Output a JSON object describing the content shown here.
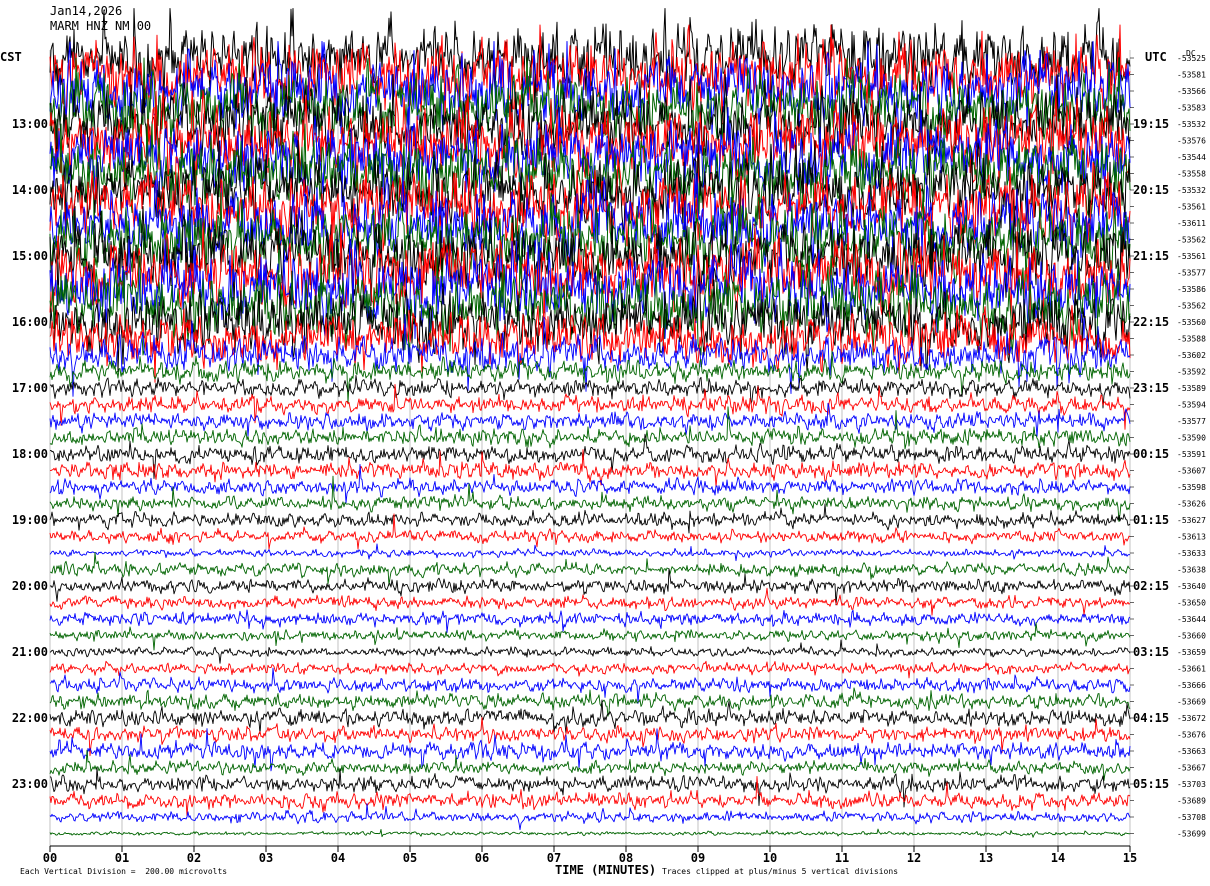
{
  "header": {
    "date": "Jan14,2026",
    "station": "MARM HNZ NM 00",
    "left_tz": "CST",
    "right_tz": "UTC",
    "dc_label": "DC"
  },
  "footer": {
    "scale_note": "Each Vertical Division =  200.00 microvolts",
    "x_title": "TIME (MINUTES)",
    "clip_note": "Traces clipped at plus/minus 5 vertical divisions"
  },
  "colors": {
    "black": "#000000",
    "red": "#ff0000",
    "blue": "#0000ff",
    "green": "#006400"
  },
  "chart_data": {
    "type": "line",
    "title": "",
    "xlabel": "TIME (MINUTES)",
    "xlim": [
      0,
      15
    ],
    "x_ticks": [
      "00",
      "01",
      "02",
      "03",
      "04",
      "05",
      "06",
      "07",
      "08",
      "09",
      "10",
      "11",
      "12",
      "13",
      "14",
      "15"
    ],
    "trace_color_cycle": [
      "black",
      "red",
      "blue",
      "green"
    ],
    "left_hour_labels": [
      "13:00",
      "14:00",
      "15:00",
      "16:00",
      "17:00",
      "18:00",
      "19:00",
      "20:00",
      "21:00",
      "22:00",
      "23:00"
    ],
    "right_hour_labels": [
      "19:15",
      "20:15",
      "21:15",
      "22:15",
      "23:15",
      "00:15",
      "01:15",
      "02:15",
      "03:15",
      "04:15",
      "05:15"
    ],
    "first_hour_label_trace": 4,
    "traces_per_hour": 4,
    "dc_offsets": [
      -53525,
      -53581,
      -53566,
      -53583,
      -53532,
      -53576,
      -53544,
      -53558,
      -53532,
      -53561,
      -53611,
      -53562,
      -53561,
      -53577,
      -53586,
      -53562,
      -53560,
      -53588,
      -53602,
      -53592,
      -53589,
      -53594,
      -53577,
      -53590,
      -53591,
      -53607,
      -53598,
      -53626,
      -53627,
      -53613,
      -53633,
      -53638,
      -53640,
      -53650,
      -53644,
      -53660,
      -53659,
      -53661,
      -53666,
      -53669,
      -53672,
      -53676,
      -53663,
      -53667,
      -53703,
      -53689,
      -53708,
      -53699
    ],
    "trace_activity": [
      8,
      8,
      8,
      8,
      8,
      8,
      8,
      8,
      8,
      8,
      8,
      8,
      8,
      8,
      8,
      8,
      7,
      6,
      4,
      2.4,
      2,
      2,
      2,
      2,
      2,
      2,
      1.8,
      1.6,
      1.6,
      1.4,
      0.8,
      1.4,
      1.6,
      1.4,
      1.5,
      1.2,
      1,
      1.2,
      1.6,
      1.8,
      2,
      1.8,
      2,
      1.5,
      1.8,
      1.8,
      1.2,
      0.4
    ],
    "grid": true
  }
}
